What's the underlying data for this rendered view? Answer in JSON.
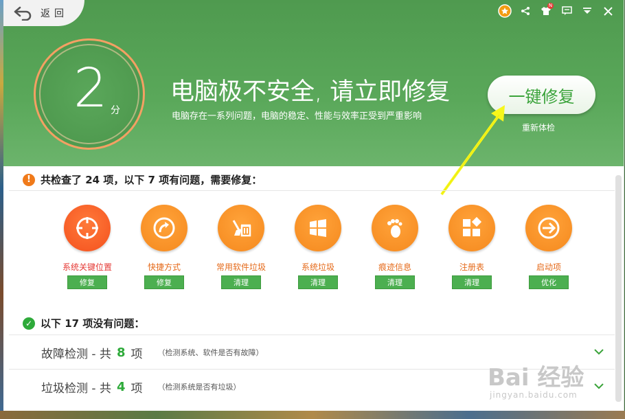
{
  "colors": {
    "header_green": "#4f9a4f",
    "accent_orange": "#f07a1a",
    "ok_green": "#2eaa3a",
    "button_green": "#4caf50"
  },
  "nav": {
    "back_label": "返回"
  },
  "top_icons": [
    "medal-icon",
    "share-icon",
    "shirt-icon",
    "feedback-icon",
    "menu-icon",
    "close-icon"
  ],
  "score": {
    "value": "2",
    "unit": "分"
  },
  "headline": "电脑极不安全, 请立即修复",
  "subline": "电脑存在一系列问题，电脑的稳定、性能与效率正受到严重影响",
  "fix_button": "一键修复",
  "recheck": "重新体检",
  "issues": {
    "title": "共检查了 24 项，以下 7 项有问题，需要修复：",
    "items": [
      {
        "label": "系统关键位置",
        "action": "修复",
        "icon": "crosshair-icon"
      },
      {
        "label": "快捷方式",
        "action": "修复",
        "icon": "shortcut-arrow-icon"
      },
      {
        "label": "常用软件垃圾",
        "action": "清理",
        "icon": "broom-trash-icon"
      },
      {
        "label": "系统垃圾",
        "action": "清理",
        "icon": "windows-logo-icon"
      },
      {
        "label": "痕迹信息",
        "action": "清理",
        "icon": "footprint-icon"
      },
      {
        "label": "注册表",
        "action": "清理",
        "icon": "registry-blocks-icon"
      },
      {
        "label": "启动项",
        "action": "优化",
        "icon": "startup-arrow-icon"
      }
    ]
  },
  "ok": {
    "title": "以下 17 项没有问题：",
    "rows": [
      {
        "name": "故障检测 - 共",
        "count": "8",
        "unit": "项",
        "desc": "（检测系统、软件是否有故障）"
      },
      {
        "name": "垃圾检测 - 共",
        "count": "4",
        "unit": "项",
        "desc": "（检测系统是否有垃圾）"
      }
    ]
  },
  "watermark": {
    "text": "Bai 经验",
    "sub": "jingyan.baidu.com"
  }
}
